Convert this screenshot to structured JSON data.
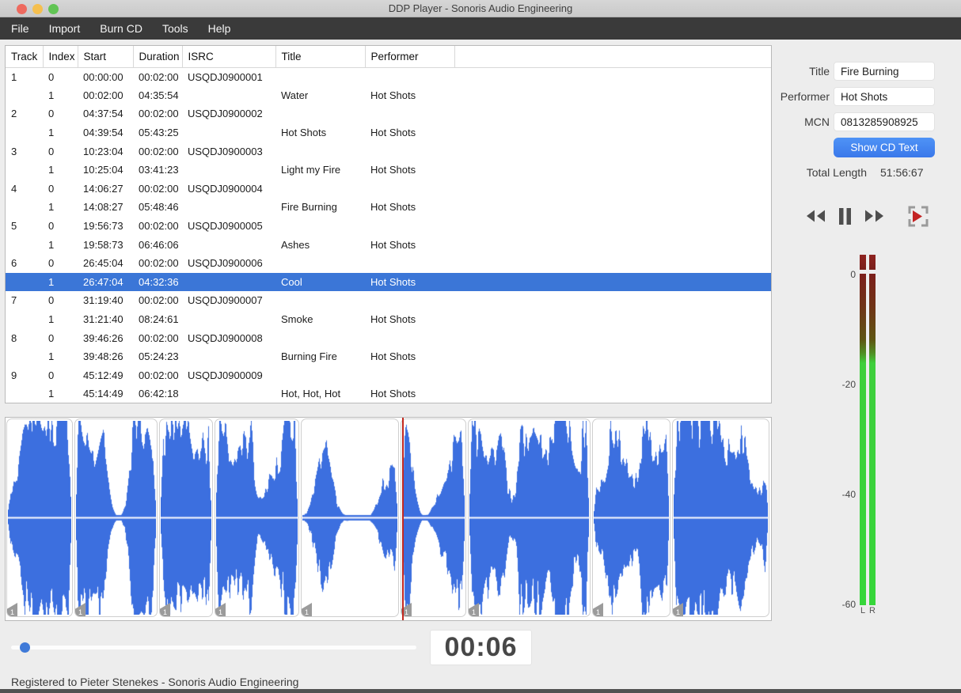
{
  "window": {
    "title": "DDP Player - Sonoris Audio Engineering"
  },
  "menu": {
    "items": [
      "File",
      "Import",
      "Burn CD",
      "Tools",
      "Help"
    ]
  },
  "table": {
    "columns": [
      "Track",
      "Index",
      "Start",
      "Duration",
      "ISRC",
      "Title",
      "Performer"
    ],
    "rows": [
      {
        "track": "1",
        "index": "0",
        "start": "00:00:00",
        "duration": "00:02:00",
        "isrc": "USQDJ0900001",
        "title": "",
        "performer": "",
        "selected": false
      },
      {
        "track": "",
        "index": "1",
        "start": "00:02:00",
        "duration": "04:35:54",
        "isrc": "",
        "title": "Water",
        "performer": "Hot Shots",
        "selected": false
      },
      {
        "track": "2",
        "index": "0",
        "start": "04:37:54",
        "duration": "00:02:00",
        "isrc": "USQDJ0900002",
        "title": "",
        "performer": "",
        "selected": false
      },
      {
        "track": "",
        "index": "1",
        "start": "04:39:54",
        "duration": "05:43:25",
        "isrc": "",
        "title": "Hot Shots",
        "performer": "Hot Shots",
        "selected": false
      },
      {
        "track": "3",
        "index": "0",
        "start": "10:23:04",
        "duration": "00:02:00",
        "isrc": "USQDJ0900003",
        "title": "",
        "performer": "",
        "selected": false
      },
      {
        "track": "",
        "index": "1",
        "start": "10:25:04",
        "duration": "03:41:23",
        "isrc": "",
        "title": "Light my Fire",
        "performer": "Hot Shots",
        "selected": false
      },
      {
        "track": "4",
        "index": "0",
        "start": "14:06:27",
        "duration": "00:02:00",
        "isrc": "USQDJ0900004",
        "title": "",
        "performer": "",
        "selected": false
      },
      {
        "track": "",
        "index": "1",
        "start": "14:08:27",
        "duration": "05:48:46",
        "isrc": "",
        "title": "Fire Burning",
        "performer": "Hot Shots",
        "selected": false
      },
      {
        "track": "5",
        "index": "0",
        "start": "19:56:73",
        "duration": "00:02:00",
        "isrc": "USQDJ0900005",
        "title": "",
        "performer": "",
        "selected": false
      },
      {
        "track": "",
        "index": "1",
        "start": "19:58:73",
        "duration": "06:46:06",
        "isrc": "",
        "title": "Ashes",
        "performer": "Hot Shots",
        "selected": false
      },
      {
        "track": "6",
        "index": "0",
        "start": "26:45:04",
        "duration": "00:02:00",
        "isrc": "USQDJ0900006",
        "title": "",
        "performer": "",
        "selected": false
      },
      {
        "track": "",
        "index": "1",
        "start": "26:47:04",
        "duration": "04:32:36",
        "isrc": "",
        "title": "Cool",
        "performer": "Hot Shots",
        "selected": true
      },
      {
        "track": "7",
        "index": "0",
        "start": "31:19:40",
        "duration": "00:02:00",
        "isrc": "USQDJ0900007",
        "title": "",
        "performer": "",
        "selected": false
      },
      {
        "track": "",
        "index": "1",
        "start": "31:21:40",
        "duration": "08:24:61",
        "isrc": "",
        "title": "Smoke",
        "performer": "Hot Shots",
        "selected": false
      },
      {
        "track": "8",
        "index": "0",
        "start": "39:46:26",
        "duration": "00:02:00",
        "isrc": "USQDJ0900008",
        "title": "",
        "performer": "",
        "selected": false
      },
      {
        "track": "",
        "index": "1",
        "start": "39:48:26",
        "duration": "05:24:23",
        "isrc": "",
        "title": "Burning Fire",
        "performer": "Hot Shots",
        "selected": false
      },
      {
        "track": "9",
        "index": "0",
        "start": "45:12:49",
        "duration": "00:02:00",
        "isrc": "USQDJ0900009",
        "title": "",
        "performer": "",
        "selected": false
      },
      {
        "track": "",
        "index": "1",
        "start": "45:14:49",
        "duration": "06:42:18",
        "isrc": "",
        "title": "Hot, Hot, Hot",
        "performer": "Hot Shots",
        "selected": false
      }
    ]
  },
  "sidebar": {
    "title_label": "Title",
    "title_value": "Fire Burning",
    "performer_label": "Performer",
    "performer_value": "Hot Shots",
    "mcn_label": "MCN",
    "mcn_value": "0813285908925",
    "show_cd_text_button": "Show CD Text",
    "total_length_label": "Total Length",
    "total_length_value": "51:56:67",
    "transport_icons": [
      "rewind-icon",
      "pause-icon",
      "fast-forward-icon",
      "play-to-marker-icon"
    ],
    "meter": {
      "scale_labels": [
        "0",
        "-20",
        "-40",
        "-60"
      ],
      "channel_labels": [
        "L",
        "R"
      ]
    }
  },
  "waveform": {
    "segments": [
      {
        "track": 1,
        "marker_label": "1",
        "duration_s": 275.72
      },
      {
        "track": 2,
        "marker_label": "1",
        "duration_s": 343.33
      },
      {
        "track": 3,
        "marker_label": "1",
        "duration_s": 221.31
      },
      {
        "track": 4,
        "marker_label": "1",
        "duration_s": 348.61
      },
      {
        "track": 5,
        "marker_label": "1",
        "duration_s": 406.08
      },
      {
        "track": 6,
        "marker_label": "1",
        "duration_s": 272.48
      },
      {
        "track": 7,
        "marker_label": "1",
        "duration_s": 504.81
      },
      {
        "track": 8,
        "marker_label": "1",
        "duration_s": 324.31
      },
      {
        "track": 9,
        "marker_label": "1",
        "duration_s": 402.24
      }
    ]
  },
  "player": {
    "time_display": "00:06"
  },
  "statusbar": {
    "text": "Registered to Pieter Stenekes - Sonoris Audio Engineering"
  },
  "colors": {
    "selection_blue": "#3b76d7",
    "waveform_blue": "#3c6fdf",
    "playhead_red": "#c3281f",
    "meter_green": "#36d63a",
    "meter_red": "#7c1e1b",
    "accent_button_blue": "#3a78ea"
  }
}
